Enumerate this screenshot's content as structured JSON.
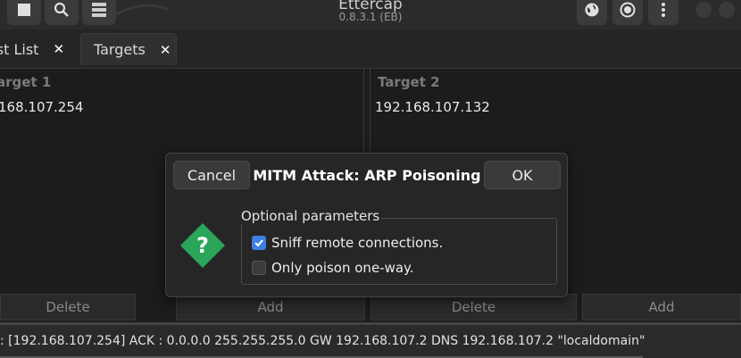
{
  "app": {
    "title": "Ettercap",
    "version": "0.8.3.1 (EB)"
  },
  "header": {
    "left_icons": [
      "stop-icon",
      "search-icon",
      "host-list-icon"
    ],
    "right_icons": [
      "globe-icon",
      "record-icon",
      "menu-dots-icon"
    ]
  },
  "tabs": [
    {
      "label": "ost List",
      "close": "✕"
    },
    {
      "label": "Targets",
      "close": "✕"
    }
  ],
  "targets": {
    "target1": {
      "header": "arget 1",
      "items": [
        "168.107.254"
      ]
    },
    "target2": {
      "header": "Target 2",
      "items": [
        "192.168.107.132"
      ]
    }
  },
  "buttons": {
    "delete1": "Delete",
    "add1": "Add",
    "delete2": "Delete",
    "add2": "Add"
  },
  "log": {
    "lines": [
      ": [192.168.107.254] ACK : 0.0.0.0 255.255.255.0 GW 192.168.107.2 DNS 192.168.107.2 \"localdomain\""
    ]
  },
  "dialog": {
    "title": "MITM Attack: ARP Poisoning",
    "cancel": "Cancel",
    "ok": "OK",
    "group_label": "Optional parameters",
    "options": [
      {
        "label": "Sniff remote connections.",
        "checked": true
      },
      {
        "label": "Only poison one-way.",
        "checked": false
      }
    ]
  },
  "colors": {
    "accent": "#3f7fe0",
    "help_icon_green": "#2aa55a"
  }
}
